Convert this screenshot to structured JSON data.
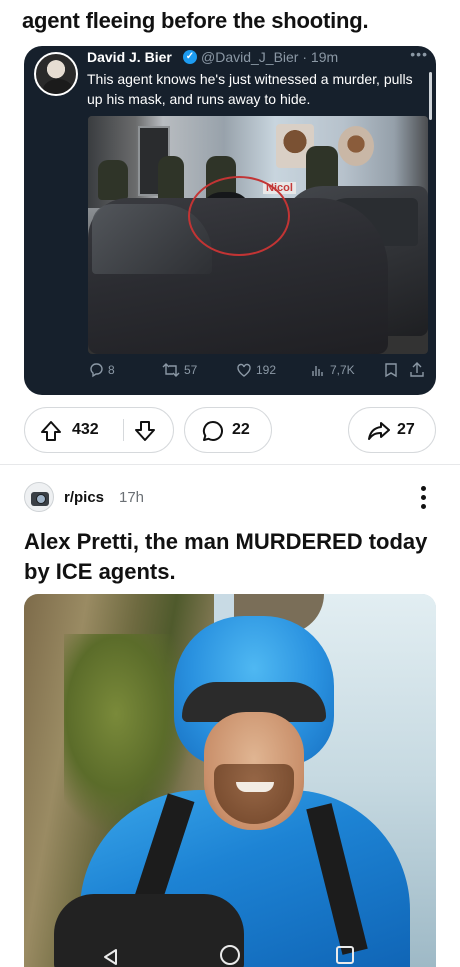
{
  "header": {
    "title": "agent fleeing before the shooting."
  },
  "tweet": {
    "author_name": "David J. Bier",
    "handle_time": "@David_J_Bier · 19m",
    "text": "This agent knows he's just witnessed a murder, pulls up his mask, and runs away to hide.",
    "media_sign": "Nicol",
    "replies": "8",
    "retweets": "57",
    "likes": "192",
    "views": "7,7K",
    "icons": [
      "reply-icon",
      "retweet-icon",
      "like-icon",
      "views-icon",
      "bookmark-icon",
      "share-icon"
    ]
  },
  "post_actions": {
    "upvotes": "432",
    "comments": "22",
    "shares": "27",
    "icons": [
      "upvote-icon",
      "downvote-icon",
      "comment-icon",
      "share-arrow-icon"
    ]
  },
  "next_post": {
    "subreddit": "r/pics",
    "age": "17h",
    "title": "Alex Pretti, the man MURDERED today by ICE agents."
  },
  "nav": {
    "icons": [
      "back-icon",
      "home-icon",
      "recents-icon"
    ]
  },
  "colors": {
    "tweet_bg": "#16202c",
    "verified": "#1d9bf0",
    "circle_annotation": "#c23434"
  }
}
